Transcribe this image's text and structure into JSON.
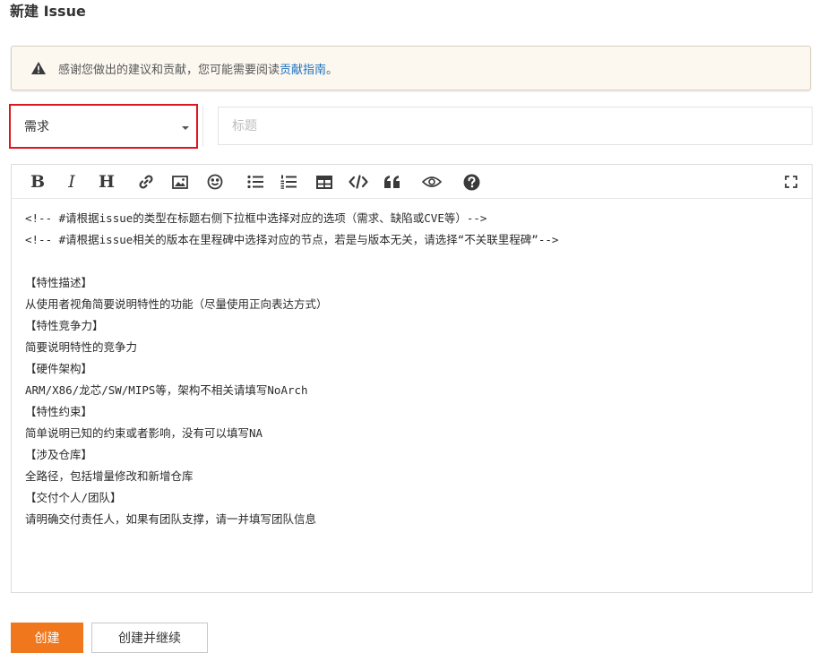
{
  "page": {
    "title": "新建 Issue"
  },
  "notice": {
    "icon": "warning-icon",
    "text": "感谢您做出的建议和贡献，您可能需要阅读",
    "link": "贡献指南",
    "suffix": "。"
  },
  "type_select": {
    "value": "需求",
    "icon": "caret-down-icon",
    "highlight_color": "#e0161e"
  },
  "title_input": {
    "value": "",
    "placeholder": "标题"
  },
  "toolbar": {
    "buttons": [
      {
        "name": "bold",
        "icon": "bold-icon"
      },
      {
        "name": "italic",
        "icon": "italic-icon"
      },
      {
        "name": "heading",
        "icon": "heading-icon"
      },
      {
        "name": "link",
        "icon": "link-icon"
      },
      {
        "name": "image",
        "icon": "image-icon"
      },
      {
        "name": "emoji",
        "icon": "emoji-icon"
      },
      {
        "name": "unordered-list",
        "icon": "bulleted-list-icon"
      },
      {
        "name": "ordered-list",
        "icon": "numbered-list-icon"
      },
      {
        "name": "table",
        "icon": "table-icon"
      },
      {
        "name": "code",
        "icon": "code-icon"
      },
      {
        "name": "quote",
        "icon": "quote-icon"
      },
      {
        "name": "preview",
        "icon": "eye-icon"
      },
      {
        "name": "help",
        "icon": "question-icon"
      },
      {
        "name": "fullscreen",
        "icon": "fullscreen-icon"
      }
    ]
  },
  "editor": {
    "lines": [
      "<!-- #请根据issue的类型在标题右侧下拉框中选择对应的选项（需求、缺陷或CVE等）-->",
      "<!-- #请根据issue相关的版本在里程碑中选择对应的节点，若是与版本无关，请选择“不关联里程碑”-->",
      "",
      "【特性描述】",
      "从使用者视角简要说明特性的功能（尽量使用正向表达方式）",
      "【特性竞争力】",
      "简要说明特性的竞争力",
      "【硬件架构】",
      "ARM/X86/龙芯/SW/MIPS等，架构不相关请填写NoArch",
      "【特性约束】",
      "简单说明已知的约束或者影响，没有可以填写NA",
      "【涉及仓库】",
      "全路径，包括增量修改和新增仓库",
      "【交付个人/团队】",
      "请明确交付责任人，如果有团队支撑，请一并填写团队信息"
    ]
  },
  "actions": {
    "create": "创建",
    "create_continue": "创建并继续"
  },
  "colors": {
    "accent": "#f0771b",
    "link": "#1e6fbf",
    "notice_bg": "#fcf8f0"
  }
}
